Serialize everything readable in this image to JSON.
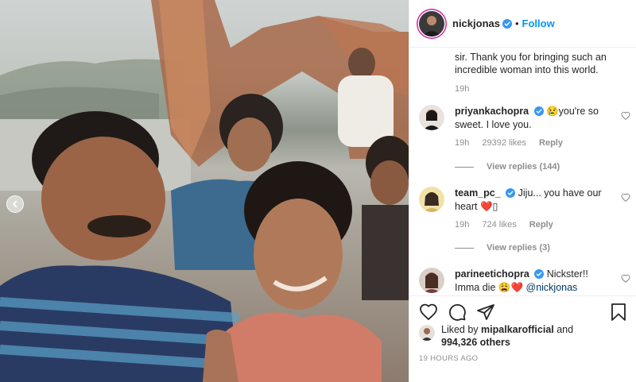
{
  "post": {
    "author": "nickjonas",
    "follow_label": "Follow",
    "separator": "•"
  },
  "caption": {
    "text_line1": "sir. Thank you for bringing such an",
    "text_line2": "incredible woman into this world.",
    "age": "19h"
  },
  "comments": [
    {
      "user": "priyankachopra",
      "text_line1": "😢you're so",
      "text_line2": "sweet. I love you.",
      "age": "19h",
      "likes": "29392 likes",
      "reply_label": "Reply",
      "view_replies": "View replies (144)"
    },
    {
      "user": "team_pc_",
      "text_line1": "Jiju... you have our",
      "text_line2": "heart ❤️▯",
      "age": "19h",
      "likes": "724 likes",
      "reply_label": "Reply",
      "view_replies": "View replies (3)"
    },
    {
      "user": "parineetichopra",
      "text_line1": "Nickster!!",
      "text_line2_prefix": "Imma die 😩❤️",
      "mention": "@nickjonas"
    }
  ],
  "likes": {
    "liked_by_prefix": "Liked by",
    "liked_by_user": "mipalkarofficial",
    "and_label": "and",
    "others_count": "994,326 others"
  },
  "timestamp": "19 HOURS AGO",
  "icons": {
    "like": "heart-icon",
    "comment": "comment-icon",
    "share": "share-icon",
    "save": "bookmark-icon",
    "verified": "verified-badge-icon",
    "prev": "chevron-left-icon"
  },
  "colors": {
    "accent": "#0095f6",
    "text": "#262626",
    "muted": "#8e8e8e",
    "verified": "#3897f0",
    "divider": "#efefef"
  }
}
